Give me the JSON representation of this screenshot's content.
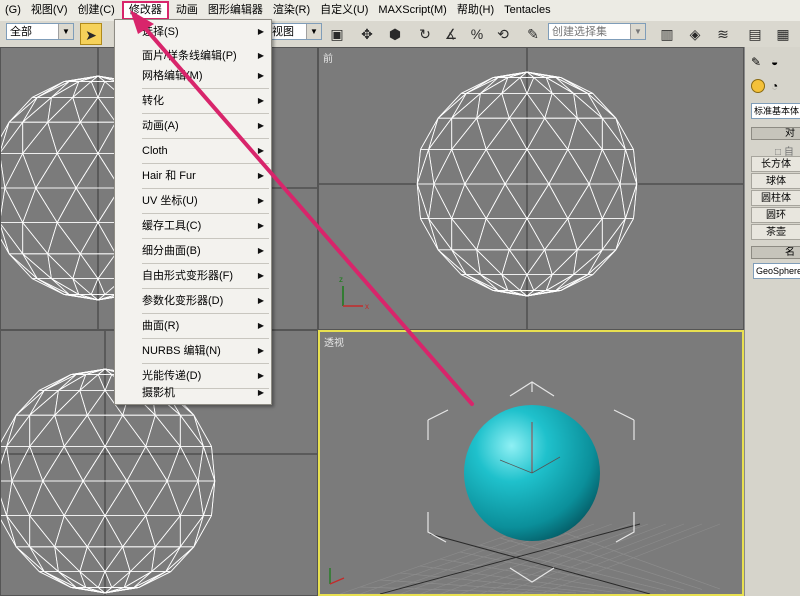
{
  "menubar": {
    "items": [
      "(G)",
      "视图(V)",
      "创建(C)",
      "修改器",
      "动画",
      "图形编辑器",
      "渲染(R)",
      "自定义(U)",
      "MAXScript(M)",
      "帮助(H)",
      "Tentacles"
    ]
  },
  "toolbar": {
    "filter_combo": "全部",
    "view_combo": "视图",
    "selection_set_placeholder": "创建选择集"
  },
  "dropdown": {
    "items": [
      {
        "label": "选择(S)"
      },
      {
        "label": "面片/样条线编辑(P)"
      },
      {
        "label": "网格编辑(M)"
      },
      {
        "label": "转化"
      },
      {
        "label": "动画(A)"
      },
      {
        "label": "Cloth"
      },
      {
        "label": "Hair 和 Fur"
      },
      {
        "label": "UV 坐标(U)"
      },
      {
        "label": "缓存工具(C)"
      },
      {
        "label": "细分曲面(B)"
      },
      {
        "label": "自由形式变形器(F)"
      },
      {
        "label": "参数化变形器(D)"
      },
      {
        "label": "曲面(R)"
      },
      {
        "label": "NURBS 编辑(N)"
      },
      {
        "label": "光能传递(D)"
      },
      {
        "label": "摄影机"
      }
    ]
  },
  "viewports": {
    "top_left_label": "",
    "front_label": "前",
    "bottom_left_label": "",
    "perspective_label": "透视"
  },
  "command_panel": {
    "category_combo": "标准基本体",
    "object_type_rollout": "对",
    "autogrid": "自",
    "buttons": [
      "长方体",
      "球体",
      "圆柱体",
      "圆环",
      "茶壶"
    ],
    "name_rollout": "名",
    "name_field": "GeoSphere"
  },
  "colors": {
    "menu_highlight": "#d8256b",
    "annotation_arrow": "#d8256b",
    "sphere_shaded": "#17b3c0",
    "viewport_active_border": "#e8e050",
    "wireframe": "#ffffff"
  }
}
